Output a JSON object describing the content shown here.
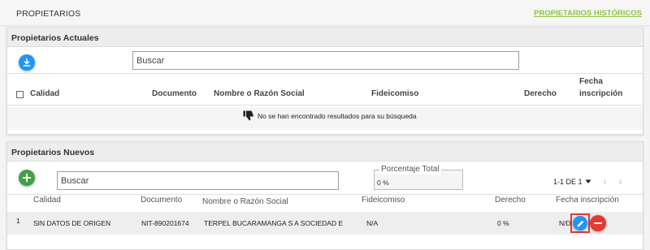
{
  "topbar": {
    "title": "PROPIETARIOS",
    "historic_link": "PROPIETARIOS HISTÓRICOS"
  },
  "actuales": {
    "title": "Propietarios Actuales",
    "search_placeholder": "Buscar",
    "columns": {
      "calidad": "Calidad",
      "documento": "Documento",
      "nombre": "Nombre o Razón Social",
      "fideicomiso": "Fideicomiso",
      "derecho": "Derecho",
      "fecha_line1": "Fecha",
      "fecha_line2": "inscripción"
    },
    "empty_message": "No se han encontrado resultados para su búsqueda"
  },
  "nuevos": {
    "title": "Propietarios Nuevos",
    "search_placeholder": "Buscar",
    "percent_label": "Porcentaje Total",
    "percent_value": "0 %",
    "pagination": "1-1 DE 1",
    "columns": {
      "calidad": "Calidad",
      "documento": "Documento",
      "nombre": "Nombre o Razón Social",
      "fideicomiso": "Fideicomiso",
      "derecho": "Derecho",
      "fecha": "Fecha inscripción"
    },
    "rows": [
      {
        "index": "1",
        "calidad": "SIN DATOS DE ORIGEN",
        "documento": "NIT-890201674",
        "nombre": "TERPEL BUCARAMANGA S A SOCIEDAD E",
        "fideicomiso": "N/A",
        "derecho": "0 %",
        "fecha": "N/D"
      }
    ]
  },
  "icons": {
    "download": "download-icon",
    "add": "plus-icon",
    "empty": "thumbs-down-icon",
    "edit": "pencil-icon",
    "remove": "minus-icon",
    "dropdown": "caret-down-icon",
    "prev": "chevron-left-icon",
    "next": "chevron-right-icon"
  },
  "colors": {
    "link_green": "#8cc63f",
    "blue_button": "#2196f3",
    "green_button": "#43a047",
    "red_button": "#e53935"
  }
}
